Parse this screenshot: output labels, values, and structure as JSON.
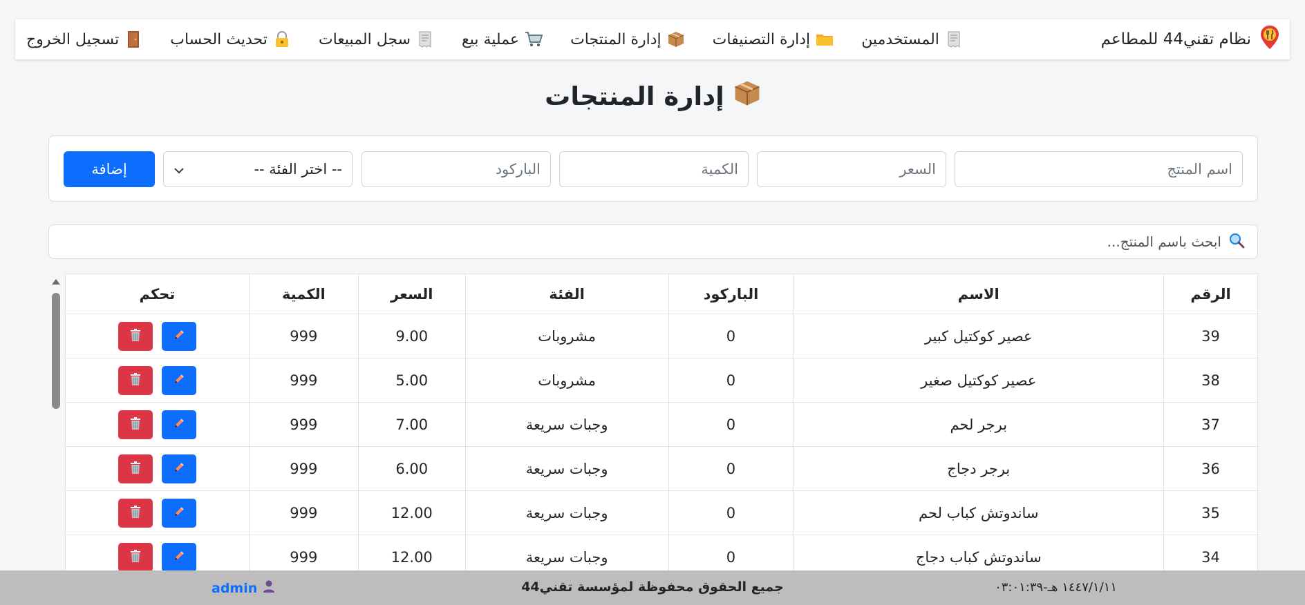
{
  "navbar": {
    "brand": "نظام تقني44 للمطاعم",
    "brand_icon": "map-pin-utensils-icon",
    "links": [
      {
        "label": "المستخدمين",
        "icon": "receipt-icon"
      },
      {
        "label": "إدارة التصنيفات",
        "icon": "folder-icon"
      },
      {
        "label": "إدارة المنتجات",
        "icon": "package-icon"
      },
      {
        "label": "عملية بيع",
        "icon": "cart-icon"
      },
      {
        "label": "سجل المبيعات",
        "icon": "receipt-icon"
      },
      {
        "label": "تحديث الحساب",
        "icon": "lock-key-icon"
      },
      {
        "label": "تسجيل الخروج",
        "icon": "door-icon"
      }
    ]
  },
  "page": {
    "title": "إدارة المنتجات",
    "title_icon": "package-icon"
  },
  "form": {
    "name_placeholder": "اسم المنتج",
    "price_placeholder": "السعر",
    "qty_placeholder": "الكمية",
    "barcode_placeholder": "الباركود",
    "category_selected": "-- اختر الفئة --",
    "add_label": "إضافة"
  },
  "search": {
    "placeholder": "ابحث باسم المنتج...",
    "icon": "magnifier-icon"
  },
  "table": {
    "headers": [
      "الرقم",
      "الاسم",
      "الباركود",
      "الفئة",
      "السعر",
      "الكمية",
      "تحكم"
    ],
    "rows": [
      {
        "id": "39",
        "name": "عصير كوكتيل كبير",
        "barcode": "0",
        "category": "مشروبات",
        "price": "9.00",
        "qty": "999"
      },
      {
        "id": "38",
        "name": "عصير كوكتيل صغير",
        "barcode": "0",
        "category": "مشروبات",
        "price": "5.00",
        "qty": "999"
      },
      {
        "id": "37",
        "name": "برجر لحم",
        "barcode": "0",
        "category": "وجبات سريعة",
        "price": "7.00",
        "qty": "999"
      },
      {
        "id": "36",
        "name": "برجر دجاج",
        "barcode": "0",
        "category": "وجبات سريعة",
        "price": "6.00",
        "qty": "999"
      },
      {
        "id": "35",
        "name": "ساندوتش كباب لحم",
        "barcode": "0",
        "category": "وجبات سريعة",
        "price": "12.00",
        "qty": "999"
      },
      {
        "id": "34",
        "name": "ساندوتش كباب دجاج",
        "barcode": "0",
        "category": "وجبات سريعة",
        "price": "12.00",
        "qty": "999"
      }
    ]
  },
  "footer": {
    "username": "admin",
    "user_icon": "user-icon",
    "copyright": "جميع الحقوق محفوظة لمؤسسة تقني44",
    "datetime": "١٤٤٧/١/١١ هـ-٠٣:٠١:٣٩"
  },
  "colors": {
    "primary": "#0d6efd",
    "danger": "#dc3545",
    "footer_bg": "#bdbdbd",
    "page_bg": "#f4f6f8"
  }
}
